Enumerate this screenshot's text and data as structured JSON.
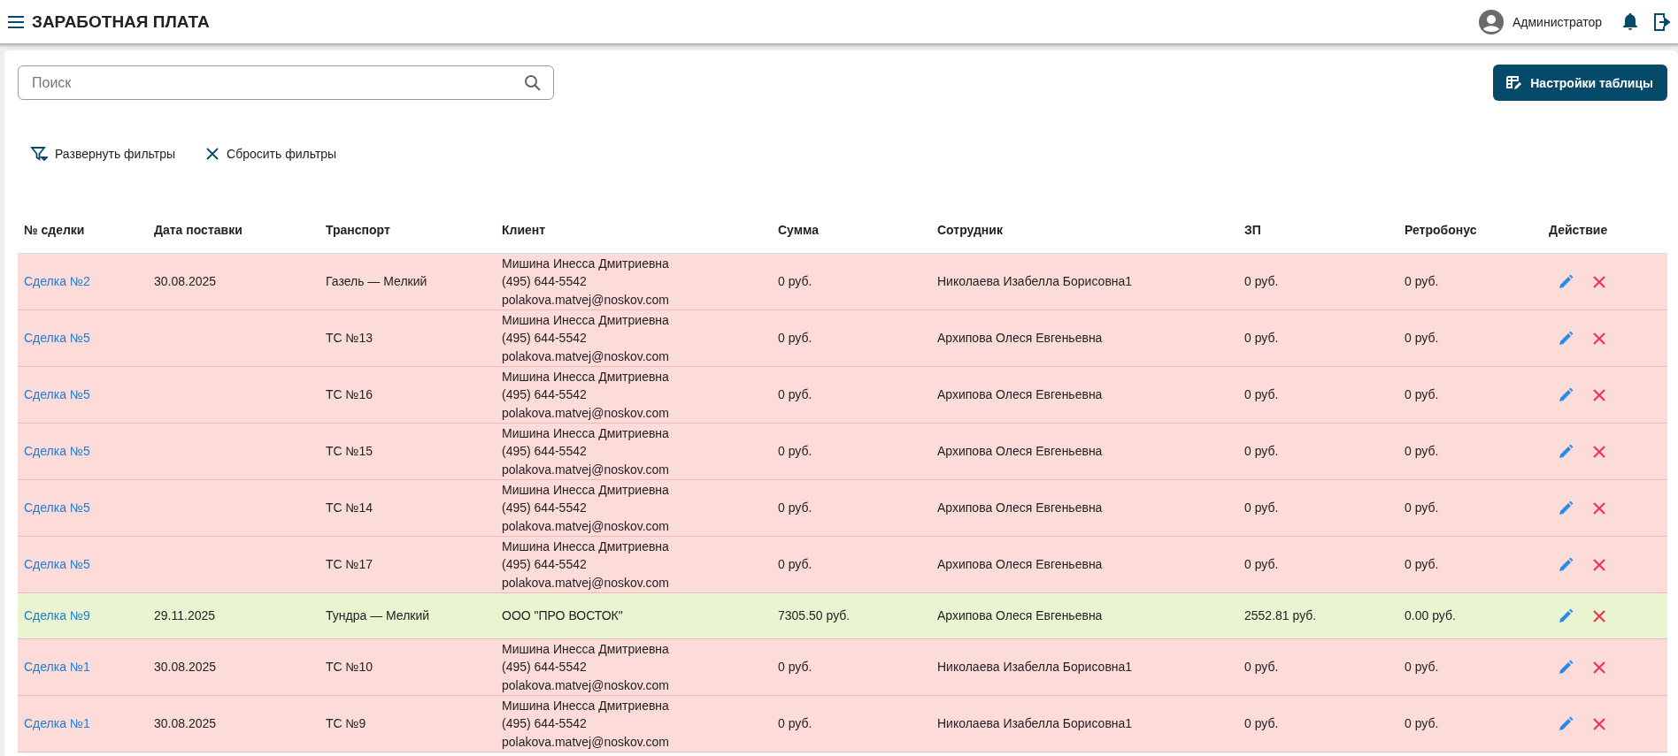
{
  "header": {
    "title": "ЗАРАБОТНАЯ ПЛАТА",
    "user": "Администратор"
  },
  "search": {
    "placeholder": "Поиск"
  },
  "settings_button": "Настройки таблицы",
  "filter_actions": [
    {
      "kind": "expand",
      "label": "Развернуть фильтры"
    },
    {
      "kind": "reset",
      "label": "Сбросить фильтры"
    }
  ],
  "table": {
    "columns": [
      "№ сделки",
      "Дата поставки",
      "Транспорт",
      "Клиент",
      "Сумма",
      "Сотрудник",
      "ЗП",
      "Ретробонус",
      "Действие"
    ],
    "rows": [
      {
        "color": "#fddbd9",
        "deal": "Сделка №2",
        "date": "30.08.2025",
        "transport": "Газель — Мелкий",
        "client": [
          "Мишина Инесса Дмитриевна",
          "(495) 644-5542",
          "polakova.matvej@noskov.com"
        ],
        "sum": "0 руб.",
        "employee": "Николаева Изабелла Борисовна1",
        "salary": "0 руб.",
        "retrobonus": "0 руб."
      },
      {
        "color": "#fddbd9",
        "deal": "Сделка №5",
        "transport": "ТС №13",
        "client": [
          "Мишина Инесса Дмитриевна",
          "(495) 644-5542",
          "polakova.matvej@noskov.com"
        ],
        "sum": "0 руб.",
        "employee": "Архипова Олеся Евгеньевна",
        "salary": "0 руб.",
        "retrobonus": "0 руб."
      },
      {
        "color": "#fddbd9",
        "deal": "Сделка №5",
        "transport": "ТС №16",
        "client": [
          "Мишина Инесса Дмитриевна",
          "(495) 644-5542",
          "polakova.matvej@noskov.com"
        ],
        "sum": "0 руб.",
        "employee": "Архипова Олеся Евгеньевна",
        "salary": "0 руб.",
        "retrobonus": "0 руб."
      },
      {
        "color": "#fddbd9",
        "deal": "Сделка №5",
        "transport": "ТС №15",
        "client": [
          "Мишина Инесса Дмитриевна",
          "(495) 644-5542",
          "polakova.matvej@noskov.com"
        ],
        "sum": "0 руб.",
        "employee": "Архипова Олеся Евгеньевна",
        "salary": "0 руб.",
        "retrobonus": "0 руб."
      },
      {
        "color": "#fddbd9",
        "deal": "Сделка №5",
        "transport": "ТС №14",
        "client": [
          "Мишина Инесса Дмитриевна",
          "(495) 644-5542",
          "polakova.matvej@noskov.com"
        ],
        "sum": "0 руб.",
        "employee": "Архипова Олеся Евгеньевна",
        "salary": "0 руб.",
        "retrobonus": "0 руб."
      },
      {
        "color": "#fddbd9",
        "deal": "Сделка №5",
        "transport": "ТС №17",
        "client": [
          "Мишина Инесса Дмитриевна",
          "(495) 644-5542",
          "polakova.matvej@noskov.com"
        ],
        "sum": "0 руб.",
        "employee": "Архипова Олеся Евгеньевна",
        "salary": "0 руб.",
        "retrobonus": "0 руб."
      },
      {
        "color": "#e8f5d0",
        "deal": "Сделка №9",
        "date": "29.11.2025",
        "transport": "Тундра — Мелкий",
        "client": [
          "ООО \"ПРО ВОСТОК\""
        ],
        "sum": "7305.50 руб.",
        "employee": "Архипова Олеся Евгеньевна",
        "salary": "2552.81 руб.",
        "retrobonus": "0.00 руб."
      },
      {
        "color": "#fddbd9",
        "deal": "Сделка №1",
        "date": "30.08.2025",
        "transport": "ТС №10",
        "client": [
          "Мишина Инесса Дмитриевна",
          "(495) 644-5542",
          "polakova.matvej@noskov.com"
        ],
        "sum": "0 руб.",
        "employee": "Николаева Изабелла Борисовна1",
        "salary": "0 руб.",
        "retrobonus": "0 руб."
      },
      {
        "color": "#fddbd9",
        "deal": "Сделка №1",
        "date": "30.08.2025",
        "transport": "ТС №9",
        "client": [
          "Мишина Инесса Дмитриевна",
          "(495) 644-5542",
          "polakova.matvej@noskov.com"
        ],
        "sum": "0 руб.",
        "employee": "Николаева Изабелла Борисовна1",
        "salary": "0 руб.",
        "retrobonus": "0 руб."
      }
    ]
  }
}
